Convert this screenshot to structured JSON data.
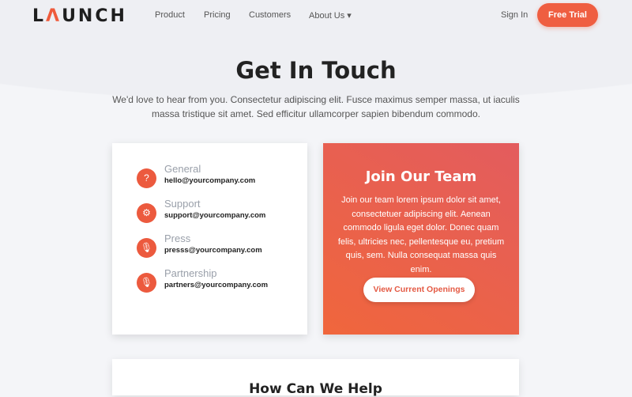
{
  "nav": {
    "logo": "LAUNCH",
    "items": [
      "Product",
      "Pricing",
      "Customers",
      "About Us ▾"
    ],
    "sign_in": "Sign In",
    "free_trial": "Free Trial"
  },
  "hero": {
    "title": "Get In Touch",
    "subtitle": "We'd love to hear from you. Consectetur adipiscing elit. Fusce maximus semper massa, ut iaculis massa tristique sit amet. Sed efficitur ullamcorper sapien bibendum commodo."
  },
  "contacts": [
    {
      "label": "General",
      "email": "hello@yourcompany.com",
      "icon": "question-icon"
    },
    {
      "label": "Support",
      "email": "support@yourcompany.com",
      "icon": "lifebuoy-icon"
    },
    {
      "label": "Press",
      "email": "presss@yourcompany.com",
      "icon": "microphone-icon"
    },
    {
      "label": "Partnership",
      "email": "partners@yourcompany.com",
      "icon": "microphone-icon"
    }
  ],
  "team": {
    "title": "Join Our Team",
    "text": "Join our team lorem ipsum dolor sit amet, consectetuer adipiscing elit. Aenean commodo ligula eget dolor. Donec quam felis, ultricies nec, pellentesque eu, pretium quis, sem. Nulla consequat massa quis enim.",
    "button": "View Current Openings"
  },
  "help": {
    "title": "How Can We Help"
  },
  "colors": {
    "accent": "#ef5e41",
    "background": "#f4f5f8"
  }
}
